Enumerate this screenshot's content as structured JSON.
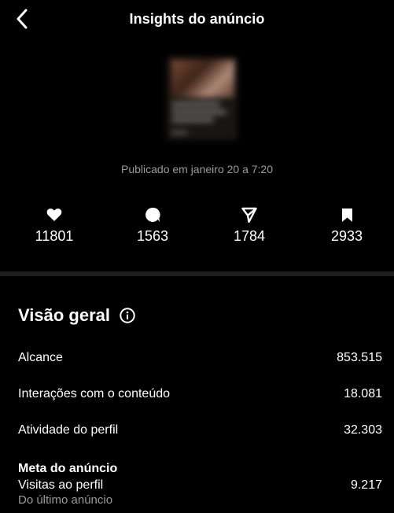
{
  "header": {
    "title": "Insights do anúncio",
    "back_icon": "chevron-left-icon"
  },
  "post": {
    "published": "Publicado em janeiro 20 a 7:20"
  },
  "stats": [
    {
      "icon": "heart-icon",
      "value": "11801"
    },
    {
      "icon": "comment-icon",
      "value": "1563"
    },
    {
      "icon": "send-icon",
      "value": "1784"
    },
    {
      "icon": "bookmark-icon",
      "value": "2933"
    }
  ],
  "overview": {
    "title": "Visão geral",
    "rows": [
      {
        "label": "Alcance",
        "value": "853.515"
      },
      {
        "label": "Interações com o conteúdo",
        "value": "18.081"
      },
      {
        "label": "Atividade do perfil",
        "value": "32.303"
      }
    ],
    "goal": {
      "title": "Meta do anúncio",
      "label": "Visitas ao perfil",
      "value": "9.217",
      "subtitle": "Do último anúncio"
    }
  },
  "colors": {
    "background": "#000000",
    "text": "#ffffff",
    "muted": "#9a9a9a",
    "divider": "#1d1d1d"
  }
}
